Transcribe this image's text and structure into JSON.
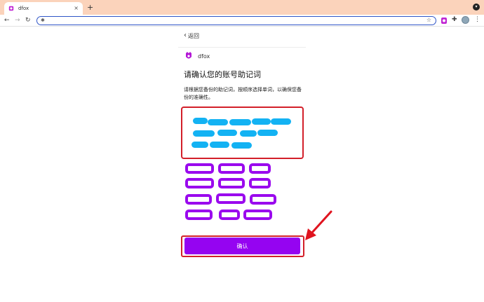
{
  "browser": {
    "tab_title": "dfox",
    "tab_close": "×",
    "new_tab": "+",
    "address_value": ""
  },
  "page": {
    "back_label": "返回",
    "brand_name": "dfox",
    "title": "请确认您的账号助记词",
    "description": "请根据您备份的助记词，按顺序选择单词，以确保您备份的准确性。",
    "confirm_label": "确认"
  },
  "colors": {
    "accent_purple": "#9504f1",
    "chip_blue": "#13b2f3",
    "highlight_red": "#d31f2a"
  }
}
